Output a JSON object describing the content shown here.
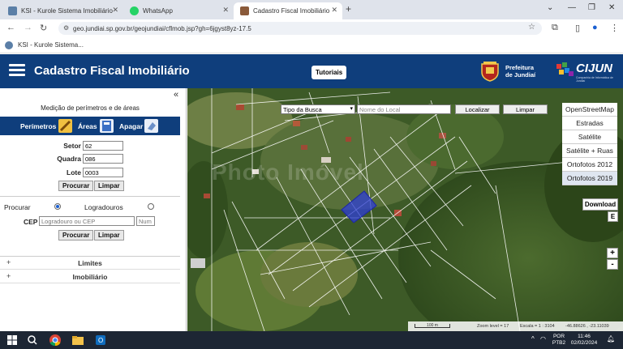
{
  "browser": {
    "tabs": [
      {
        "label": "KSI - Kurole Sistema Imobiliário",
        "active": false
      },
      {
        "label": "WhatsApp",
        "active": false
      },
      {
        "label": "Cadastro Fiscal Imobiliário",
        "active": true
      }
    ],
    "url": "geo.jundiai.sp.gov.br/geojundiai/cflmob.jsp?gh=6jgyst8yz-17.5",
    "bookmark": "KSI - Kurole Sistema..."
  },
  "header": {
    "title": "Cadastro Fiscal Imobiliário",
    "tutorials": "Tutoriais",
    "prefeitura_line1": "Prefeitura",
    "prefeitura_line2": "de Jundiaí",
    "cijun": "CIJUN",
    "cijun_sub": "Companhia de Informática de Jundiaí"
  },
  "panel": {
    "collapse": "«",
    "title": "Medição de perímetros e de áreas",
    "tools": {
      "perimetros": "Perímetros",
      "areas": "Áreas",
      "apagar": "Apagar"
    },
    "setor_label": "Setor",
    "setor_value": "62",
    "quadra_label": "Quadra",
    "quadra_value": "086",
    "lote_label": "Lote",
    "lote_value": "0003",
    "procurar_btn": "Procurar",
    "limpar_btn": "Limpar",
    "procurar_label": "Procurar",
    "logradouros_label": "Logradouros",
    "cep_label": "CEP",
    "cep_placeholder": "Logradouro ou CEP",
    "num_placeholder": "Num",
    "procurar_btn2": "Procurar",
    "limpar_btn2": "Limpar",
    "limites": "Limites",
    "imobiliario": "Imobiliário",
    "plus": "+"
  },
  "map": {
    "tipo_busca": "Tipo da Busca",
    "nome_local_placeholder": "Nome do Local",
    "localizar": "Localizar",
    "limpar": "Limpar",
    "layers": [
      "OpenStreetMap",
      "Estradas",
      "Satélite",
      "Satélite + Ruas",
      "Ortofotos 2012",
      "Ortofotos 2019"
    ],
    "selected_layer": "Ortofotos 2019",
    "download": "Download",
    "download_e": "E",
    "zoom_in": "+",
    "zoom_out": "-",
    "scale": "100 m",
    "zoom_level": "Zoom level = 17",
    "escala": "Escala = 1 : 3104",
    "coords": "-46.88626 , -23.11039",
    "watermark": "Photo Imóvel"
  },
  "taskbar": {
    "lang_line1": "POR",
    "lang_line2": "PTB2",
    "time": "11:46",
    "date": "02/02/2024"
  },
  "colors": {
    "header_blue": "#0f3e7c",
    "selection_blue": "#2f3fd6"
  }
}
